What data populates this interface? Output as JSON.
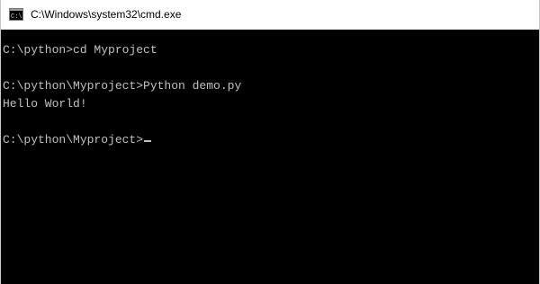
{
  "window": {
    "title": "C:\\Windows\\system32\\cmd.exe",
    "icon": "cmd-icon"
  },
  "console": {
    "lines": [
      "C:\\python>cd Myproject",
      "",
      "C:\\python\\Myproject>Python demo.py",
      "Hello World!",
      "",
      "C:\\python\\Myproject>"
    ]
  },
  "colors": {
    "background": "#000000",
    "text": "#c0c0c0",
    "titlebar": "#ffffff"
  }
}
